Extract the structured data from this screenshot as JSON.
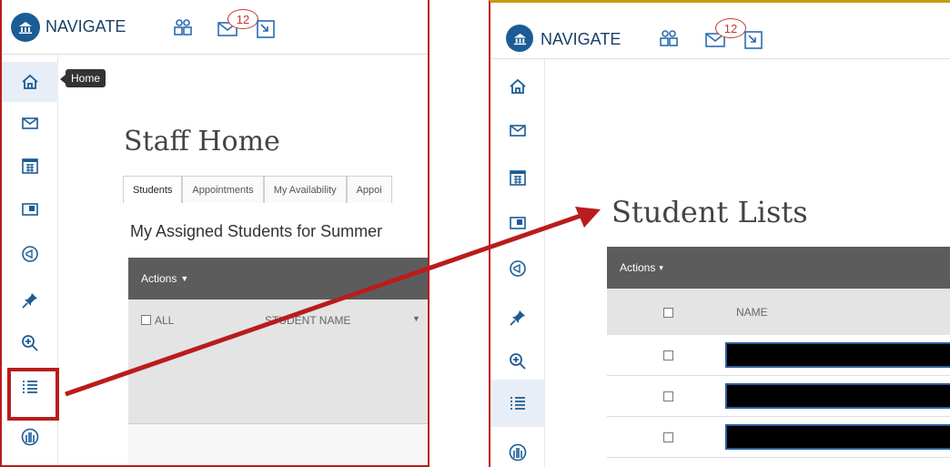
{
  "left": {
    "brand": "NAVIGATE",
    "badge_count": "12",
    "tooltip": "Home",
    "title": "Staff Home",
    "tabs": [
      "Students",
      "Appointments",
      "My Availability",
      "Appoi"
    ],
    "subheading": "My Assigned Students for Summer",
    "actions_label": "Actions",
    "all_label": "ALL",
    "student_name_header": "STUDENT NAME"
  },
  "right": {
    "brand": "NAVIGATE",
    "badge_count": "12",
    "title": "Student Lists",
    "actions_label": "Actions",
    "name_header": "NAME"
  },
  "colors": {
    "brand_blue": "#1c5c94",
    "highlight_red": "#b91c1c",
    "actions_bg": "#5c5c5c"
  },
  "sidebar_icons": [
    "home-icon",
    "mail-icon",
    "calendar-icon",
    "folder-icon",
    "megaphone-icon",
    "pin-icon",
    "search-zoom-icon",
    "list-icon",
    "building-icon"
  ]
}
